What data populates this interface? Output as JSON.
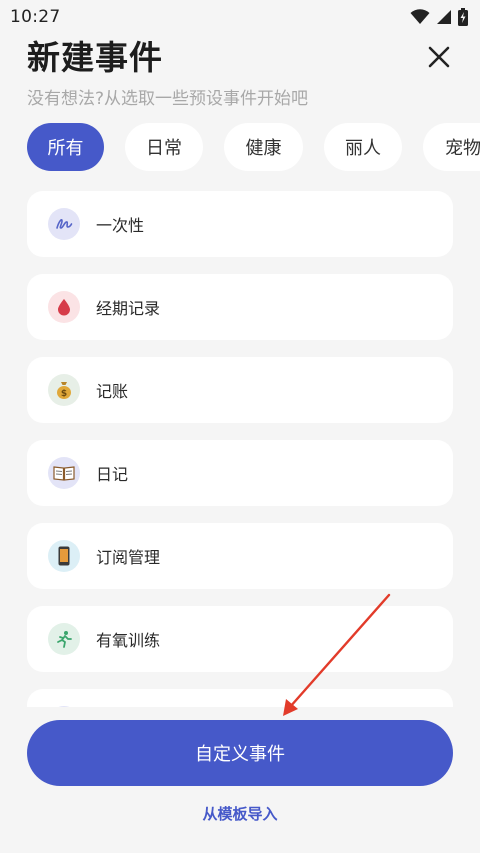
{
  "status_bar": {
    "time": "10:27",
    "icons": [
      "wifi-icon",
      "signal-icon",
      "battery-charging-icon"
    ]
  },
  "header": {
    "title": "新建事件",
    "subtitle": "没有想法?从选取一些预设事件开始吧",
    "close_icon": "close-icon"
  },
  "tabs": [
    {
      "label": "所有",
      "active": true
    },
    {
      "label": "日常",
      "active": false
    },
    {
      "label": "健康",
      "active": false
    },
    {
      "label": "丽人",
      "active": false
    },
    {
      "label": "宠物",
      "active": false
    }
  ],
  "events": [
    {
      "label": "一次性",
      "icon": "signature-icon",
      "icon_bg": "#e3e4f7"
    },
    {
      "label": "经期记录",
      "icon": "blood-drop-icon",
      "icon_bg": "#fbe3e5"
    },
    {
      "label": "记账",
      "icon": "money-bag-icon",
      "icon_bg": "#e7efe7"
    },
    {
      "label": "日记",
      "icon": "open-book-icon",
      "icon_bg": "#e3e4f7"
    },
    {
      "label": "订阅管理",
      "icon": "mobile-phone-icon",
      "icon_bg": "#dceff6"
    },
    {
      "label": "有氧训练",
      "icon": "running-person-icon",
      "icon_bg": "#e2f1e8"
    },
    {
      "label": "",
      "icon": "",
      "icon_bg": "#e3e4f7"
    }
  ],
  "actions": {
    "custom_event": "自定义事件",
    "import_template": "从模板导入"
  },
  "colors": {
    "accent": "#4659c9",
    "background": "#f5f5f5",
    "card": "#ffffff",
    "annotation_arrow": "#e23b2a"
  }
}
